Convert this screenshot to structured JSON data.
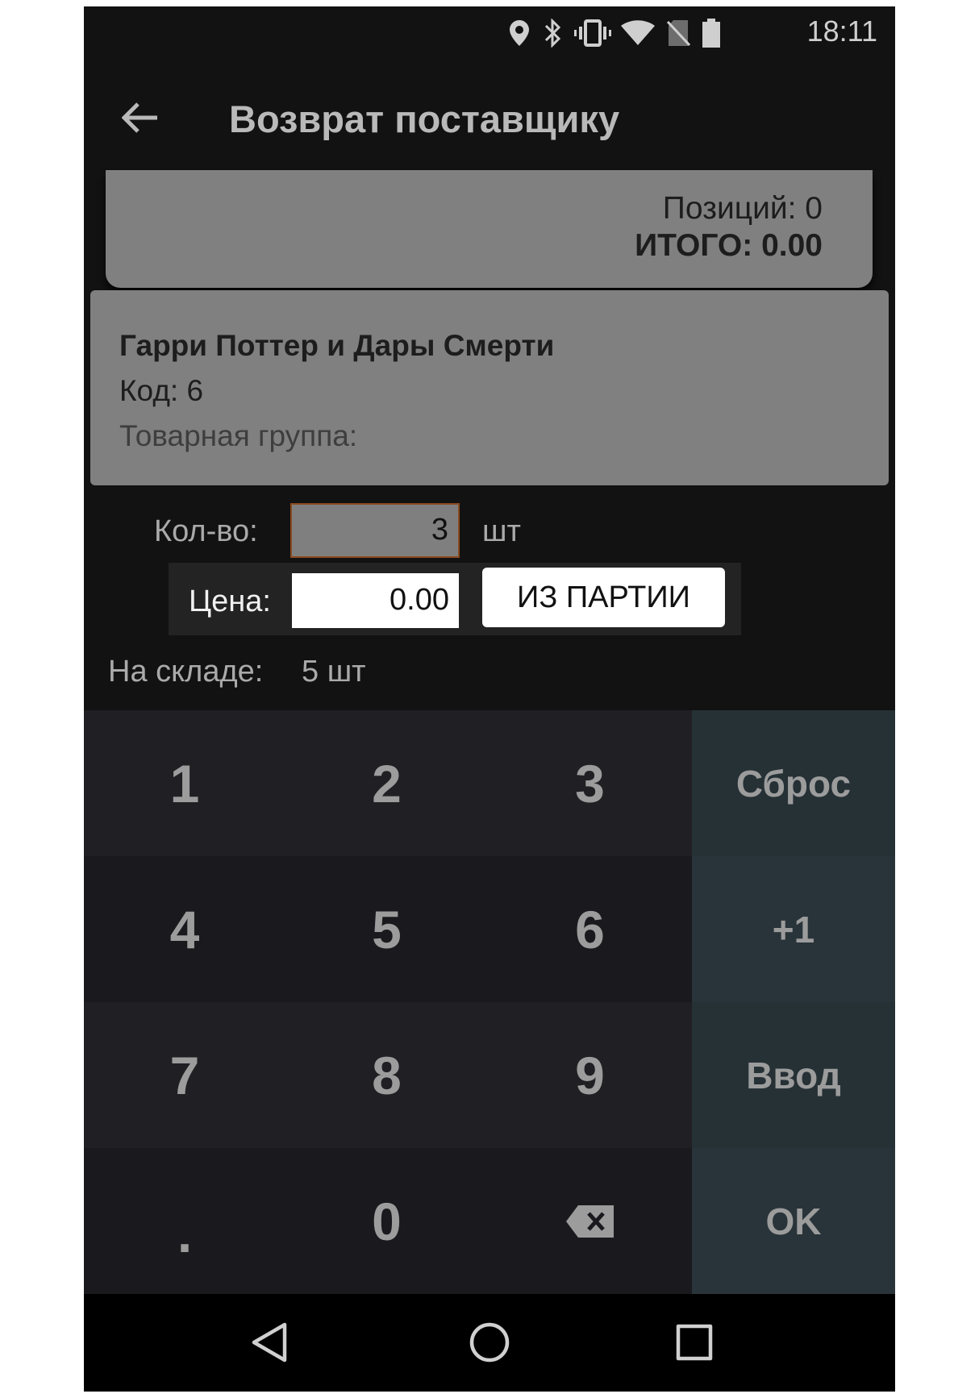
{
  "status_bar": {
    "time": "18:11",
    "icons": [
      "location-icon",
      "bluetooth-icon",
      "vibrate-icon",
      "wifi-icon",
      "no-sim-icon",
      "battery-icon"
    ]
  },
  "app_bar": {
    "title": "Возврат поставщику",
    "back_icon": "arrow-back-icon"
  },
  "totals": {
    "positions": "Позиций: 0",
    "total": "ИТОГО: 0.00"
  },
  "product": {
    "name": "Гарри Поттер и Дары Смерти",
    "code": "Код: 6",
    "group": "Товарная группа:"
  },
  "quantity": {
    "label": "Кол-во:",
    "value": "3",
    "unit": "шт"
  },
  "price": {
    "label": "Цена:",
    "value": "0.00",
    "batch_button": "ИЗ ПАРТИИ"
  },
  "stock": {
    "label": "На складе:",
    "value": "5 шт"
  },
  "keypad": {
    "digits": [
      "1",
      "2",
      "3",
      "4",
      "5",
      "6",
      "7",
      "8",
      "9",
      ".",
      "0"
    ],
    "backspace_icon": "backspace-icon",
    "reset": "Сброс",
    "plus_one": "+1",
    "enter": "Ввод",
    "ok": "OK",
    "colors": {
      "bg_a": "#202024",
      "bg_b": "#1a1a1e",
      "fn_bg": "#263136",
      "text": "#9c9c9c"
    }
  },
  "nav_bar": {
    "icons": [
      "back-triangle-icon",
      "home-circle-icon",
      "recents-square-icon"
    ]
  }
}
